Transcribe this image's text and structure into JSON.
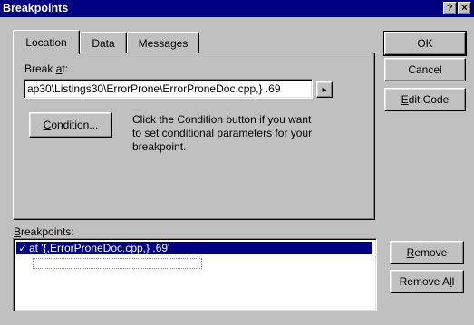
{
  "window": {
    "title": "Breakpoints",
    "help_btn": "?",
    "close_btn": "×"
  },
  "tabs": [
    {
      "label": "Location",
      "active": true
    },
    {
      "label": "Data",
      "active": false
    },
    {
      "label": "Messages",
      "active": false
    }
  ],
  "location": {
    "break_at_label_prefix": "Break ",
    "break_at_label_accel": "a",
    "break_at_label_suffix": "t:",
    "break_at_value": "ap30\\Listings30\\ErrorProne\\ErrorProneDoc.cpp,} .69",
    "arrow_btn": "▸",
    "condition_btn_accel": "C",
    "condition_btn_rest": "ondition...",
    "condition_help": "Click the Condition button if you want to set conditional parameters for your breakpoint."
  },
  "buttons": {
    "ok": "OK",
    "cancel": "Cancel",
    "edit_code_accel": "E",
    "edit_code_rest": "dit Code",
    "remove_accel": "R",
    "remove_rest": "emove",
    "remove_all_prefix": "Remove A",
    "remove_all_accel": "l",
    "remove_all_suffix": "l"
  },
  "breakpoints": {
    "label_accel": "B",
    "label_rest": "reakpoints:",
    "items": [
      {
        "checked": true,
        "text": "at '{,ErrorProneDoc.cpp,} .69'",
        "selected": true
      }
    ]
  }
}
